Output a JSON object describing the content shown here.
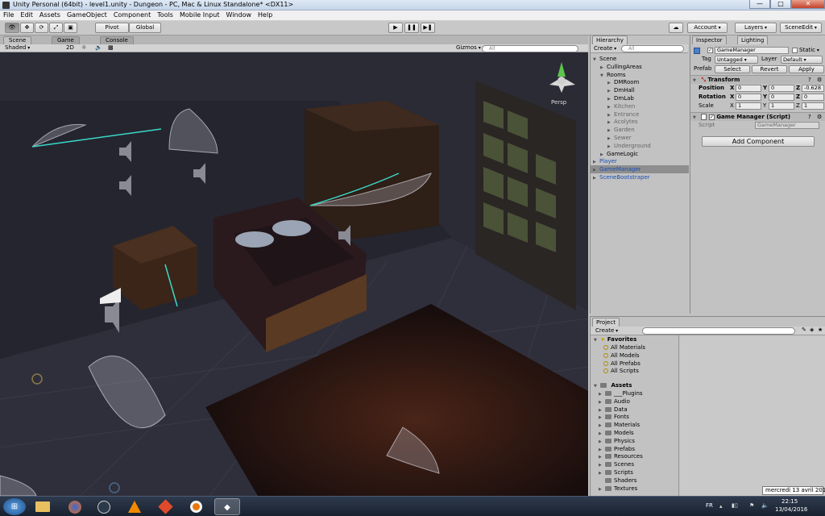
{
  "window": {
    "title": "Unity Personal (64bit) - level1.unity - Dungeon - PC, Mac & Linux Standalone* <DX11>",
    "minimize": "—",
    "maximize": "□",
    "close": "✕"
  },
  "menu": [
    "File",
    "Edit",
    "Assets",
    "GameObject",
    "Component",
    "Tools",
    "Mobile Input",
    "Window",
    "Help"
  ],
  "toolbar": {
    "pivot": "Pivot",
    "global": "Global",
    "account": "Account",
    "layers": "Layers",
    "layout": "SceneEdit"
  },
  "scene": {
    "tabs": [
      "Scene",
      "Game",
      "Console"
    ],
    "shading": "Shaded",
    "mode_2d": "2D",
    "gizmos": "Gizmos",
    "search_placeholder": "All",
    "persp_label": "Persp"
  },
  "hierarchy": {
    "tab": "Hierarchy",
    "create": "Create",
    "search_placeholder": "All",
    "items": [
      {
        "label": "Scene",
        "indent": 0,
        "expanded": true
      },
      {
        "label": "CullingAreas",
        "indent": 1,
        "expanded": false
      },
      {
        "label": "Rooms",
        "indent": 1,
        "expanded": true
      },
      {
        "label": "DMRoom",
        "indent": 2,
        "expanded": false
      },
      {
        "label": "DmHall",
        "indent": 2,
        "expanded": false
      },
      {
        "label": "DmLab",
        "indent": 2,
        "expanded": false
      },
      {
        "label": "Kitchen",
        "indent": 2,
        "expanded": false,
        "dim": true
      },
      {
        "label": "Entrance",
        "indent": 2,
        "expanded": false,
        "dim": true
      },
      {
        "label": "Acolytes",
        "indent": 2,
        "expanded": false,
        "dim": true
      },
      {
        "label": "Garden",
        "indent": 2,
        "expanded": false,
        "dim": true
      },
      {
        "label": "Sewer",
        "indent": 2,
        "expanded": false,
        "dim": true
      },
      {
        "label": "Underground",
        "indent": 2,
        "expanded": false,
        "dim": true
      },
      {
        "label": "GameLogic",
        "indent": 1,
        "expanded": false
      },
      {
        "label": "Player",
        "indent": 0,
        "blue": true
      },
      {
        "label": "GameManager",
        "indent": 0,
        "blue": true,
        "selected": true
      },
      {
        "label": "SceneBootstraper",
        "indent": 0,
        "blue": true
      }
    ]
  },
  "inspector": {
    "tabs": [
      "Inspector",
      "Lighting"
    ],
    "object_name": "GameManager",
    "static_label": "Static",
    "tag_label": "Tag",
    "tag_value": "Untagged",
    "layer_label": "Layer",
    "layer_value": "Default",
    "prefab_label": "Prefab",
    "prefab_buttons": [
      "Select",
      "Revert",
      "Apply"
    ],
    "transform": {
      "title": "Transform",
      "position": {
        "label": "Position",
        "x": "0",
        "y": "0",
        "z": "-0.628"
      },
      "rotation": {
        "label": "Rotation",
        "x": "0",
        "y": "0",
        "z": "0"
      },
      "scale": {
        "label": "Scale",
        "x": "1",
        "y": "1",
        "z": "1"
      }
    },
    "script_component": {
      "title": "Game Manager (Script)",
      "script_label": "Script",
      "script_value": "GameManager"
    },
    "add_component": "Add Component"
  },
  "project": {
    "tab": "Project",
    "create": "Create",
    "favorites": {
      "label": "Favorites",
      "items": [
        "All Materials",
        "All Models",
        "All Prefabs",
        "All Scripts"
      ]
    },
    "assets": {
      "label": "Assets",
      "items": [
        "___Plugins",
        "Audio",
        "Data",
        "Fonts",
        "Materials",
        "Models",
        "Physics",
        "Prefabs",
        "Resources",
        "Scenes",
        "Scripts",
        "Shaders",
        "Textures"
      ]
    }
  },
  "taskbar": {
    "lang": "FR",
    "time": "22:15",
    "date": "13/04/2016",
    "tooltip": "mercredi 13 avril 2016"
  }
}
